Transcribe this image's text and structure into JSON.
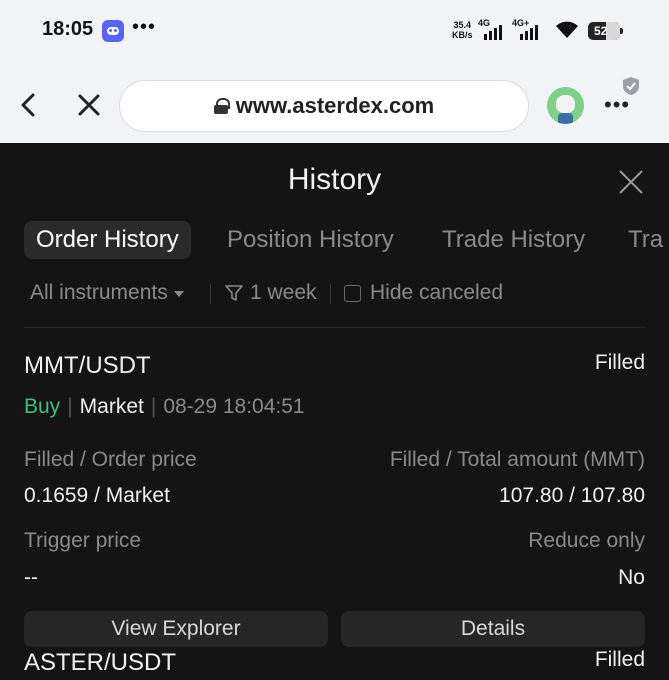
{
  "statusbar": {
    "time": "18:05",
    "dots": "•••",
    "speed_value": "35.4",
    "speed_unit": "KB/s",
    "net1": "4G",
    "net2": "4G+",
    "battery": "52"
  },
  "browser": {
    "url": "www.asterdex.com",
    "menu": "⋮"
  },
  "panel": {
    "title": "History",
    "tabs": [
      {
        "label": "Order History",
        "active": true
      },
      {
        "label": "Position History",
        "active": false
      },
      {
        "label": "Trade History",
        "active": false
      },
      {
        "label": "Tra",
        "active": false
      }
    ],
    "filters": {
      "instruments": "All instruments",
      "period": "1 week",
      "hide_canceled": "Hide canceled"
    }
  },
  "orders": [
    {
      "pair": "MMT/USDT",
      "status": "Filled",
      "side": "Buy",
      "type": "Market",
      "time": "08-29 18:04:51",
      "filled_order_price_label": "Filled / Order price",
      "filled_order_price_value": "0.1659 / Market",
      "filled_total_label": "Filled / Total amount (MMT)",
      "filled_total_value": "107.80 / 107.80",
      "trigger_label": "Trigger price",
      "trigger_value": "--",
      "reduce_label": "Reduce only",
      "reduce_value": "No",
      "view_explorer": "View Explorer",
      "details": "Details"
    },
    {
      "pair": "ASTER/USDT",
      "status": "Filled"
    }
  ]
}
